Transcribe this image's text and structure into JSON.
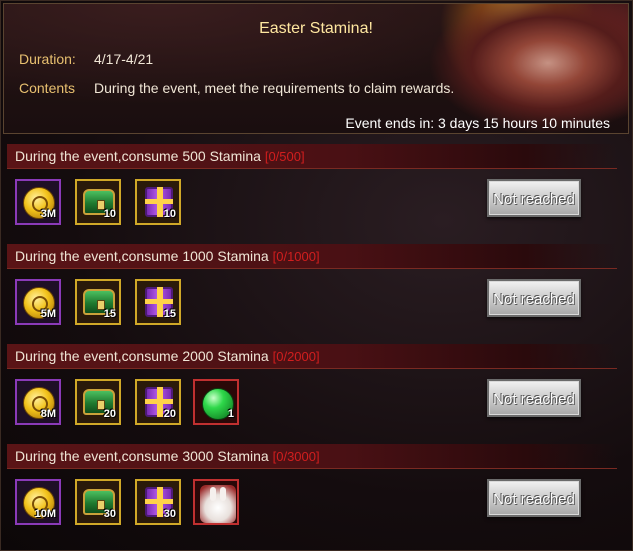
{
  "header": {
    "title": "Easter Stamina!",
    "duration_label": "Duration:",
    "duration_value": "4/17-4/21",
    "contents_label": "Contents",
    "contents_value": "During the event, meet the requirements to claim rewards.",
    "countdown": "Event ends in: 3 days 15 hours 10 minutes"
  },
  "tiers": [
    {
      "title": "During the event,consume 500 Stamina",
      "progress": "[0/500]",
      "rewards": [
        {
          "icon": "gold-coin-icon",
          "qty": "3M"
        },
        {
          "icon": "green-chest-icon",
          "qty": "10"
        },
        {
          "icon": "purple-gift-icon",
          "qty": "10"
        }
      ],
      "button": "Not reached"
    },
    {
      "title": "During the event,consume 1000 Stamina",
      "progress": "[0/1000]",
      "rewards": [
        {
          "icon": "gold-coin-icon",
          "qty": "5M"
        },
        {
          "icon": "green-chest-icon",
          "qty": "15"
        },
        {
          "icon": "purple-gift-icon",
          "qty": "15"
        }
      ],
      "button": "Not reached"
    },
    {
      "title": "During the event,consume 2000 Stamina",
      "progress": "[0/2000]",
      "rewards": [
        {
          "icon": "gold-coin-icon",
          "qty": "8M"
        },
        {
          "icon": "green-chest-icon",
          "qty": "20"
        },
        {
          "icon": "purple-gift-icon",
          "qty": "20"
        },
        {
          "icon": "green-orb-icon",
          "qty": "1"
        }
      ],
      "button": "Not reached"
    },
    {
      "title": "During the event,consume 3000 Stamina",
      "progress": "[0/3000]",
      "rewards": [
        {
          "icon": "gold-coin-icon",
          "qty": "10M"
        },
        {
          "icon": "green-chest-icon",
          "qty": "30"
        },
        {
          "icon": "purple-gift-icon",
          "qty": "30"
        },
        {
          "icon": "bunny-icon",
          "qty": ""
        }
      ],
      "button": "Not reached"
    }
  ],
  "colors": {
    "title_gold": "#ffe7a0",
    "label_gold": "#e8c070",
    "progress_red": "#d11e1e",
    "section_bar_red": "#5a1416"
  }
}
